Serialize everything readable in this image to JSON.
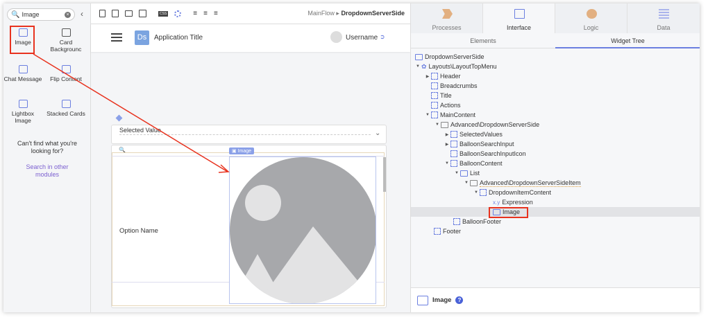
{
  "left_panel": {
    "search_value": "Image",
    "widgets": [
      {
        "label": "Image"
      },
      {
        "label": "Card Backgrounc"
      },
      {
        "label": "Chat Message"
      },
      {
        "label": "Flip Content"
      },
      {
        "label": "Lightbox Image"
      },
      {
        "label": "Stacked Cards"
      }
    ],
    "cant_find": "Can't find what you're looking for?",
    "search_other": "Search in other modules"
  },
  "toolbar": {
    "breadcrumb_parent": "MainFlow",
    "breadcrumb_current": "DropdownServerSide",
    "css_label": "CSS"
  },
  "canvas": {
    "logo": "Ds",
    "app_title": "Application Title",
    "username": "Username",
    "selected_value": "Selected Value",
    "image_badge": "Image",
    "option_name": "Option Name"
  },
  "right_panel": {
    "tabs": [
      {
        "label": "Processes"
      },
      {
        "label": "Interface"
      },
      {
        "label": "Logic"
      },
      {
        "label": "Data"
      }
    ],
    "subtabs": [
      "Elements",
      "Widget Tree"
    ],
    "tree": [
      "DropdownServerSide",
      "Layouts\\LayoutTopMenu",
      "Header",
      "Breadcrumbs",
      "Title",
      "Actions",
      "MainContent",
      "Advanced\\DropdownServerSide",
      "SelectedValues",
      "BalloonSearchInput",
      "BalloonSearchInputIcon",
      "BalloonContent",
      "List",
      "Advanced\\DropdownServerSideItem",
      "DropdownItemContent",
      "x.y",
      "Expression",
      "Image",
      "BalloonFooter",
      "Footer"
    ],
    "properties_title": "Image",
    "help": "?"
  },
  "colors": {
    "accent": "#6b7fe0",
    "highlight": "#e8321e"
  }
}
